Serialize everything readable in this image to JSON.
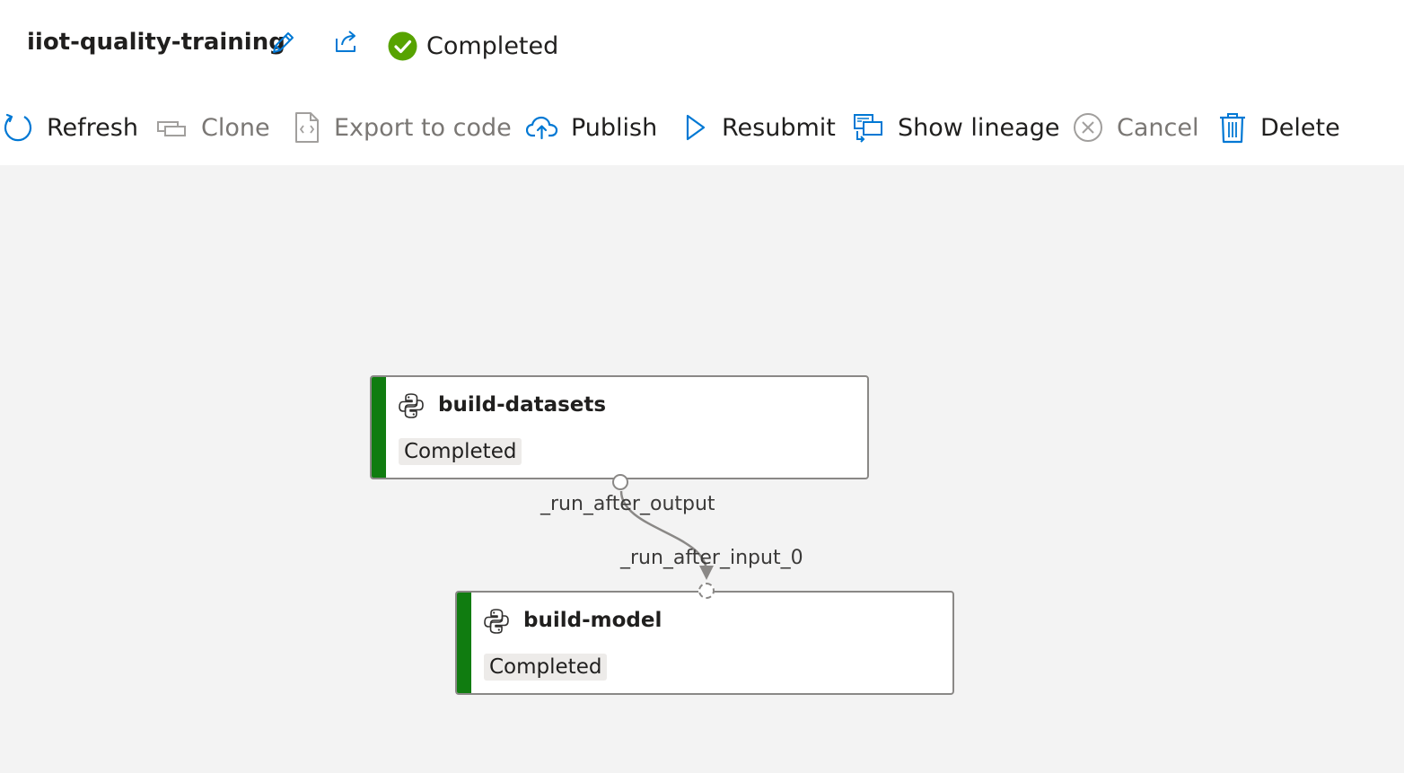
{
  "header": {
    "title": "iiot-quality-training",
    "status": "Completed",
    "status_color": "#57a300",
    "edit_icon": "pencil-icon",
    "share_icon": "share-icon"
  },
  "toolbar": {
    "refresh": "Refresh",
    "clone": "Clone",
    "export": "Export to code",
    "publish": "Publish",
    "resubmit": "Resubmit",
    "lineage": "Show lineage",
    "cancel": "Cancel",
    "delete": "Delete",
    "accent_color": "#0078d4",
    "disabled_color": "#a19f9d"
  },
  "graph": {
    "nodes": [
      {
        "title": "build-datasets",
        "status": "Completed",
        "icon": "python-icon",
        "status_color": "#107c10"
      },
      {
        "title": "build-model",
        "status": "Completed",
        "icon": "python-icon",
        "status_color": "#107c10"
      }
    ],
    "edge": {
      "output_port": "_run_after_output",
      "input_port": "_run_after_input_0"
    }
  }
}
